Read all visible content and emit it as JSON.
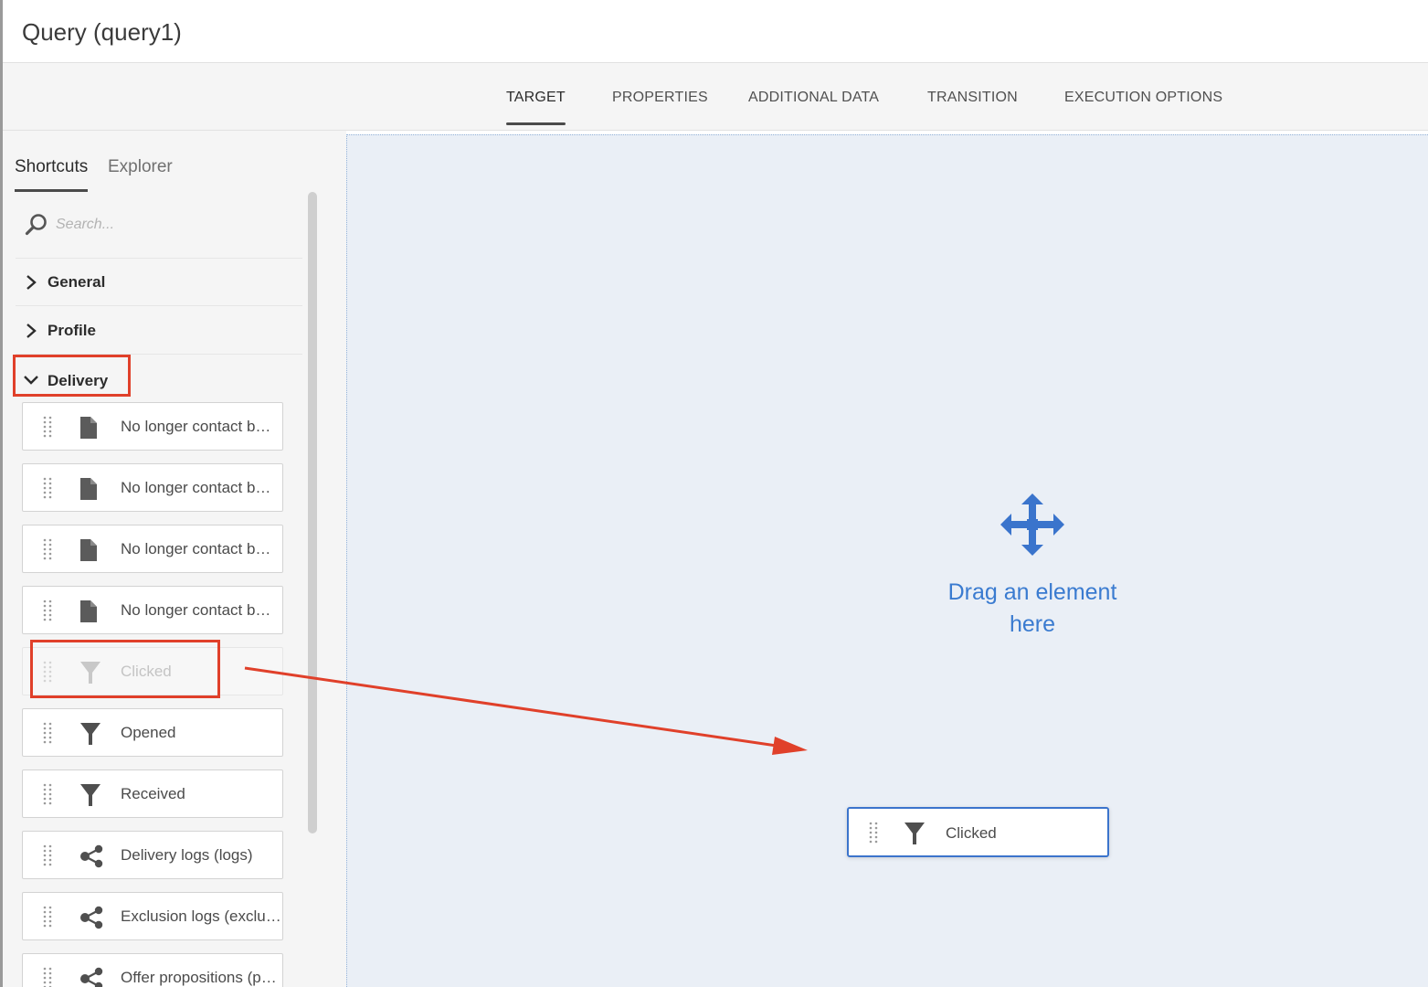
{
  "window": {
    "title": "Query (query1)"
  },
  "tabs": [
    {
      "label": "TARGET",
      "active": true
    },
    {
      "label": "PROPERTIES",
      "active": false
    },
    {
      "label": "ADDITIONAL DATA",
      "active": false
    },
    {
      "label": "TRANSITION",
      "active": false
    },
    {
      "label": "EXECUTION OPTIONS",
      "active": false
    }
  ],
  "sidebar": {
    "tabs": [
      {
        "label": "Shortcuts",
        "active": true
      },
      {
        "label": "Explorer",
        "active": false
      }
    ],
    "search": {
      "placeholder": "Search...",
      "value": ""
    },
    "sections": [
      {
        "label": "General",
        "expanded": false,
        "icon": "chevron-right-icon"
      },
      {
        "label": "Profile",
        "expanded": false,
        "icon": "chevron-right-icon"
      },
      {
        "label": "Delivery",
        "expanded": true,
        "icon": "chevron-down-icon"
      }
    ],
    "items": [
      {
        "label": "No longer contact b…",
        "icon": "document-icon"
      },
      {
        "label": "No longer contact b…",
        "icon": "document-icon"
      },
      {
        "label": "No longer contact b…",
        "icon": "document-icon"
      },
      {
        "label": "No longer contact b…",
        "icon": "document-icon"
      },
      {
        "label": "Clicked",
        "icon": "filter-icon",
        "state": "dragging-ghost"
      },
      {
        "label": "Opened",
        "icon": "filter-icon"
      },
      {
        "label": "Received",
        "icon": "filter-icon"
      },
      {
        "label": "Delivery logs (logs)",
        "icon": "share-link-icon"
      },
      {
        "label": "Exclusion logs (exclu…",
        "icon": "share-link-icon"
      },
      {
        "label": "Offer propositions (p…",
        "icon": "share-link-icon"
      }
    ]
  },
  "dropzone": {
    "message_line1": "Drag an element",
    "message_line2": "here",
    "icon": "move-arrows-icon"
  },
  "dragging_item": {
    "label": "Clicked",
    "icon": "filter-icon"
  },
  "colors": {
    "accent_blue": "#3a7bd0",
    "annotation_red": "#e0402a",
    "dropzone_bg": "#eaeff6"
  }
}
